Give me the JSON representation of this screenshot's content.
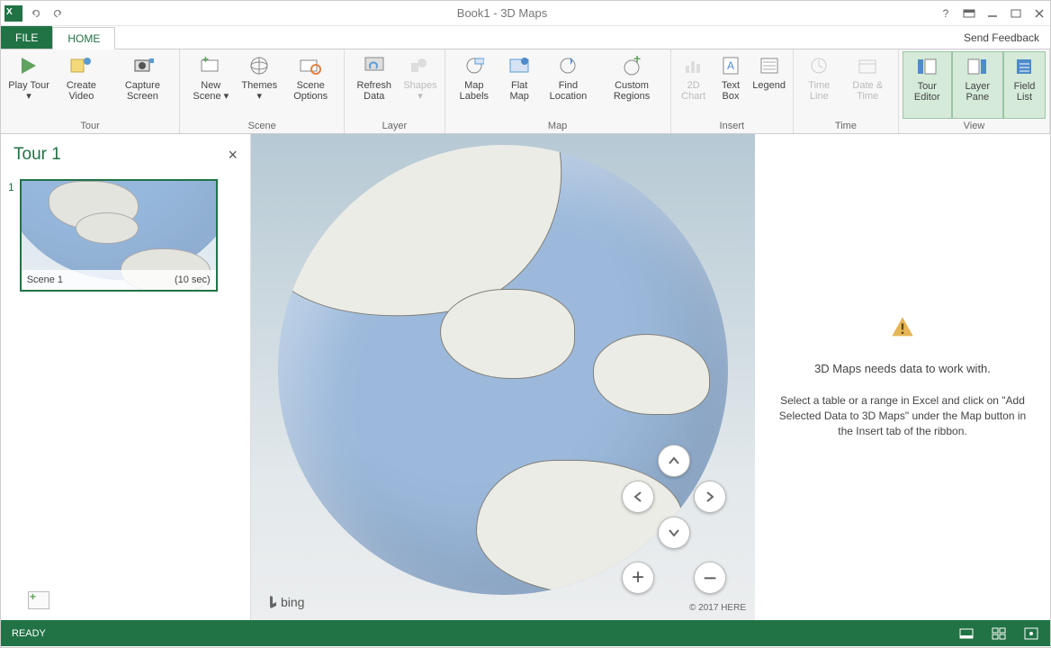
{
  "title": "Book1 - 3D Maps",
  "feedback": "Send Feedback",
  "tabs": {
    "file": "FILE",
    "home": "HOME"
  },
  "ribbon": {
    "tour_group": "Tour",
    "scene_group": "Scene",
    "layer_group": "Layer",
    "map_group": "Map",
    "insert_group": "Insert",
    "time_group": "Time",
    "view_group": "View",
    "play_tour": "Play Tour",
    "create_video": "Create Video",
    "capture_screen": "Capture Screen",
    "new_scene": "New Scene",
    "themes": "Themes",
    "scene_options": "Scene Options",
    "refresh_data": "Refresh Data",
    "shapes": "Shapes",
    "map_labels": "Map Labels",
    "flat_map": "Flat Map",
    "find_location": "Find Location",
    "custom_regions": "Custom Regions",
    "chart_2d": "2D Chart",
    "text_box": "Text Box",
    "legend": "Legend",
    "time_line": "Time Line",
    "date_time": "Date & Time",
    "tour_editor": "Tour Editor",
    "layer_pane": "Layer Pane",
    "field_list": "Field List"
  },
  "left": {
    "tour_title": "Tour 1",
    "scene_num": "1",
    "scene_name": "Scene 1",
    "scene_duration": "(10 sec)"
  },
  "map": {
    "bing": "bing",
    "copyright": "© 2017 HERE"
  },
  "right": {
    "heading": "3D Maps needs data to work with.",
    "body": "Select a table or a range in Excel and click on \"Add Selected Data to 3D Maps\" under the Map button in the Insert tab of the ribbon."
  },
  "status": {
    "ready": "READY"
  }
}
